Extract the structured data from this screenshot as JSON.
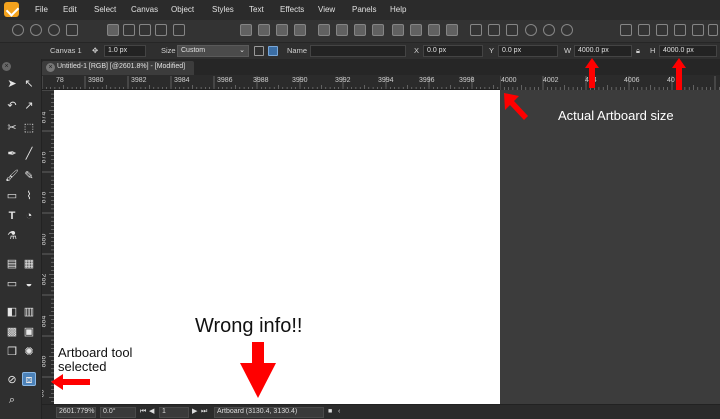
{
  "menu": [
    "File",
    "Edit",
    "Select",
    "Canvas",
    "Object",
    "Styles",
    "Text",
    "Effects",
    "View",
    "Panels",
    "Help"
  ],
  "context_bar": {
    "canvas_name": "Canvas 1",
    "stroke_width": "1.0 px",
    "size_label": "Size",
    "size_value": "Custom",
    "name_label": "Name",
    "name_value": "",
    "x_label": "X",
    "x_value": "0.0 px",
    "y_label": "Y",
    "y_value": "0.0 px",
    "w_label": "W",
    "w_value": "4000.0 px",
    "h_label": "H",
    "h_value": "4000.0 px"
  },
  "document_tab": {
    "title": "Untitled-1 [RGB] [@2601.8%] - [Modified]"
  },
  "ruler_h": [
    "78",
    "3980",
    "3982",
    "3984",
    "3986",
    "3988",
    "3990",
    "3992",
    "3994",
    "3996",
    "3998",
    "4000",
    "4002",
    "404",
    "4006",
    "40"
  ],
  "ruler_v": [
    "874",
    "876",
    "878",
    "880",
    "882",
    "884",
    "886",
    "88"
  ],
  "status_bar": {
    "zoom": "2601.779%",
    "rotation": "0.0°",
    "page": "1",
    "selection": "Artboard (3130.4, 3130.4)"
  },
  "annotations": {
    "actual_size": "Actual Artboard size",
    "wrong_info": "Wrong info!!",
    "tool_selected_line1": "Artboard tool",
    "tool_selected_line2": "selected"
  },
  "colors": {
    "accent": "#4c82b9",
    "logo": "#f3a21d",
    "annotation_arrow": "#ff0000"
  }
}
